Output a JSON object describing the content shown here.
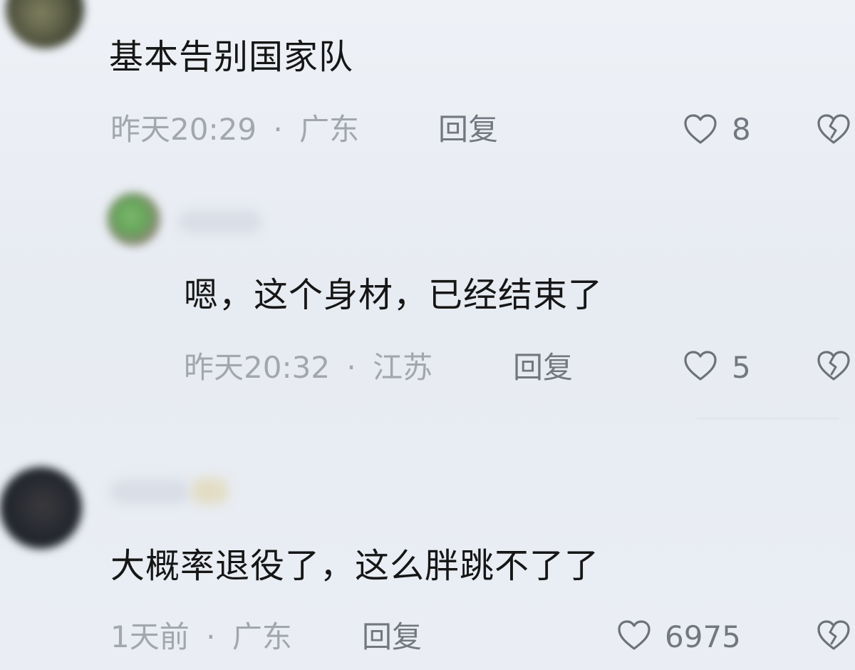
{
  "comments": [
    {
      "text": "基本告别国家队",
      "time": "昨天20:29",
      "location": "广东",
      "reply_label": "回复",
      "likes": "8"
    },
    {
      "text": "嗯，这个身材，已经结束了",
      "time": "昨天20:32",
      "location": "江苏",
      "reply_label": "回复",
      "likes": "5"
    },
    {
      "text": "大概率退役了，这么胖跳不了了",
      "time": "1天前",
      "location": "广东",
      "reply_label": "回复",
      "likes": "6975"
    }
  ],
  "meta_separator": "·",
  "icons": {
    "like": "heart-outline-icon",
    "dislike": "broken-heart-icon"
  },
  "colors": {
    "background": "#e9edf4",
    "text": "#161616",
    "meta": "#a2a6ad",
    "action": "#737780"
  }
}
